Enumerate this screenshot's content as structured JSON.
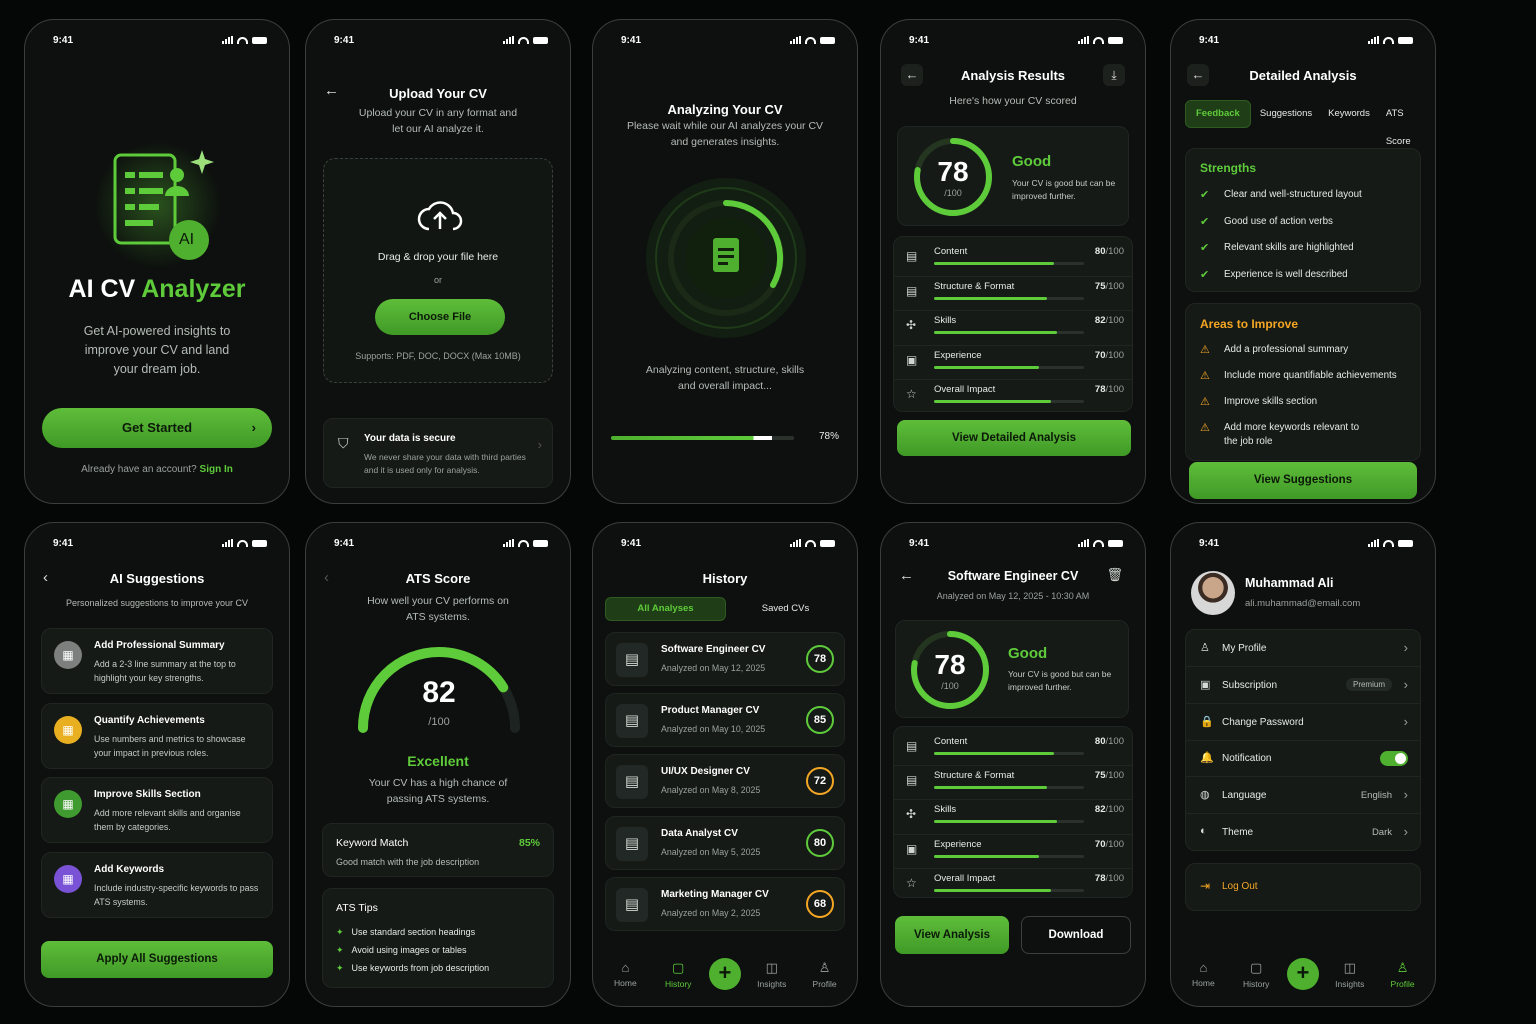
{
  "status_time": "9:41",
  "accent": "#5ecb3a",
  "warn": "#f4a623",
  "welcome": {
    "title_a": "AI CV ",
    "title_b": "Analyzer",
    "desc": "Get AI-powered insights to improve your CV and land your dream job.",
    "logo_text": "AI",
    "cta": "Get Started",
    "signin_prompt": "Already have an account? ",
    "signin_link": "Sign In"
  },
  "upload": {
    "title": "Upload Your CV",
    "desc": "Upload your CV in any format and let our AI analyze it.",
    "drag": "Drag & drop your file here",
    "or": "or",
    "choose": "Choose File",
    "supports": "Supports: PDF, DOC, DOCX (Max 10MB)",
    "secure_title": "Your data is secure",
    "secure_desc": "We never share your data with third parties and it is used only for analysis."
  },
  "analyzing": {
    "title": "Analyzing Your CV",
    "desc": "Please wait while our AI analyzes your CV and generates insights.",
    "status": "Analyzing content, structure, skills and overall impact...",
    "progress": 78,
    "progress_label": "78%"
  },
  "results": {
    "title": "Analysis Results",
    "subtitle": "Here's how your CV scored",
    "score": "78",
    "score_max": "/100",
    "rating": "Good",
    "rating_desc": "Your CV is good but can be improved further.",
    "metrics": [
      {
        "label": "Content",
        "value": "80",
        "max": "/100",
        "pct": 80
      },
      {
        "label": "Structure & Format",
        "value": "75",
        "max": "/100",
        "pct": 75
      },
      {
        "label": "Skills",
        "value": "82",
        "max": "/100",
        "pct": 82
      },
      {
        "label": "Experience",
        "value": "70",
        "max": "/100",
        "pct": 70
      },
      {
        "label": "Overall Impact",
        "value": "78",
        "max": "/100",
        "pct": 78
      }
    ],
    "cta": "View Detailed Analysis"
  },
  "detailed": {
    "title": "Detailed Analysis",
    "tabs": [
      "Feedback",
      "Suggestions",
      "Keywords",
      "ATS Score"
    ],
    "strengths_title": "Strengths",
    "strengths": [
      "Clear and well-structured layout",
      "Good use of action verbs",
      "Relevant skills are highlighted",
      "Experience is well described"
    ],
    "improve_title": "Areas to Improve",
    "improve": [
      "Add a professional summary",
      "Include more quantifiable achievements",
      "Improve skills section",
      "Add more keywords relevant to the job role"
    ],
    "cta": "View Suggestions"
  },
  "suggestions": {
    "title": "AI Suggestions",
    "subtitle": "Personalized suggestions to improve your CV",
    "items": [
      {
        "title": "Add Professional Summary",
        "desc": "Add a 2-3 line summary at the top to highlight your key strengths.",
        "color": "#7d7f7e"
      },
      {
        "title": "Quantify Achievements",
        "desc": "Use numbers and metrics to showcase your impact in previous roles.",
        "color": "#e8b020"
      },
      {
        "title": "Improve Skills Section",
        "desc": "Add more relevant skills and organise them by categories.",
        "color": "#3f9a2f"
      },
      {
        "title": "Add Keywords",
        "desc": "Include industry-specific keywords to pass ATS systems.",
        "color": "#7a52d6"
      }
    ],
    "cta": "Apply All Suggestions"
  },
  "ats": {
    "title": "ATS Score",
    "desc": "How well your CV performs on ATS systems.",
    "score": "82",
    "score_max": "/100",
    "pct": 82,
    "rating": "Excellent",
    "rating_desc": "Your CV has a high chance of passing ATS systems.",
    "kw_title": "Keyword Match",
    "kw_value": "85%",
    "kw_desc": "Good match with the job description",
    "tips_title": "ATS Tips",
    "tips": [
      "Use standard section headings",
      "Avoid using images or tables",
      "Use keywords from job description"
    ]
  },
  "history": {
    "title": "History",
    "tabs": [
      "All Analyses",
      "Saved CVs"
    ],
    "items": [
      {
        "name": "Software Engineer CV",
        "date": "Analyzed on May 12, 2025",
        "score": "78",
        "color": "#5ecb3a"
      },
      {
        "name": "Product Manager CV",
        "date": "Analyzed on May 10, 2025",
        "score": "85",
        "color": "#5ecb3a"
      },
      {
        "name": "UI/UX Designer CV",
        "date": "Analyzed on May 8, 2025",
        "score": "72",
        "color": "#f4a623"
      },
      {
        "name": "Data Analyst CV",
        "date": "Analyzed on May 5, 2025",
        "score": "80",
        "color": "#5ecb3a"
      },
      {
        "name": "Marketing Manager CV",
        "date": "Analyzed on May 2, 2025",
        "score": "68",
        "color": "#f4a623"
      }
    ]
  },
  "nav": {
    "home": "Home",
    "history": "History",
    "insights": "Insights",
    "profile": "Profile"
  },
  "detail": {
    "title": "Software Engineer CV",
    "date": "Analyzed on May 12, 2025 - 10:30 AM",
    "view": "View Analysis",
    "download": "Download"
  },
  "profile": {
    "name": "Muhammad Ali",
    "email": "ali.muhammad@email.com",
    "menu": [
      {
        "label": "My Profile",
        "value": ""
      },
      {
        "label": "Subscription",
        "value": "Premium"
      },
      {
        "label": "Change Password",
        "value": ""
      },
      {
        "label": "Notification",
        "value": ""
      },
      {
        "label": "Language",
        "value": "English"
      },
      {
        "label": "Theme",
        "value": "Dark"
      }
    ],
    "logout": "Log Out"
  }
}
